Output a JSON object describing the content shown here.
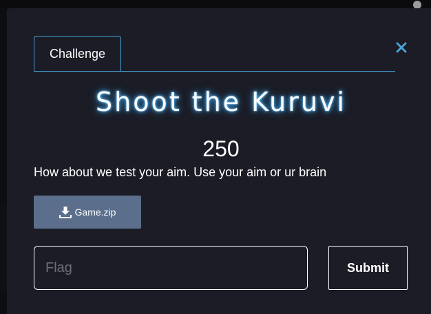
{
  "modal": {
    "tabs": [
      {
        "label": "Challenge"
      }
    ],
    "close_icon": "close-x-icon",
    "challenge": {
      "name": "Shoot the Kuruvi",
      "points": "250",
      "description": "How about we test your aim. Use your aim or ur brain",
      "file": {
        "icon": "download-icon",
        "label": "Game.zip"
      }
    },
    "flag_input": {
      "placeholder": "Flag",
      "value": ""
    },
    "submit_label": "Submit"
  },
  "colors": {
    "modal_background": "#1b1c25",
    "page_background": "#0d0e13",
    "accent_border": "#4aa3d9",
    "title_glow": "#4fb8ff",
    "download_button": "#5b6e8c",
    "text": "#ffffff"
  }
}
